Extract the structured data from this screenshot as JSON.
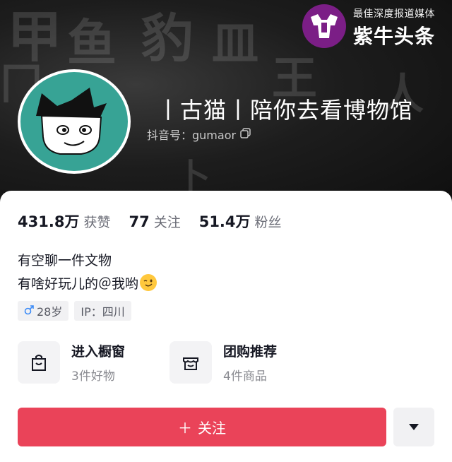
{
  "watermark": {
    "tagline": "最佳深度报道媒体",
    "brand": "紫牛头条"
  },
  "profile": {
    "title": "丨古猫丨陪你去看博物馆",
    "douyin_id": "抖音号：gumaor"
  },
  "stats": [
    {
      "value": "431.8万",
      "label": "获赞"
    },
    {
      "value": "77",
      "label": "关注"
    },
    {
      "value": "51.4万",
      "label": "粉丝"
    }
  ],
  "bio": {
    "line1": "有空聊一件文物",
    "line2": "有啥好玩儿的＠我哟"
  },
  "tags": {
    "gender_age": "28岁",
    "ip": "IP：四川"
  },
  "entries": [
    {
      "title": "进入橱窗",
      "subtitle": "3件好物",
      "icon": "shopping-bag-icon"
    },
    {
      "title": "团购推荐",
      "subtitle": "4件商品",
      "icon": "store-icon"
    }
  ],
  "actions": {
    "follow_label": "关注",
    "follow_plus": "＋"
  },
  "colors": {
    "accent": "#ea4359",
    "avatar_bg": "#37a395",
    "watermark_logo": "#7b1e86"
  }
}
